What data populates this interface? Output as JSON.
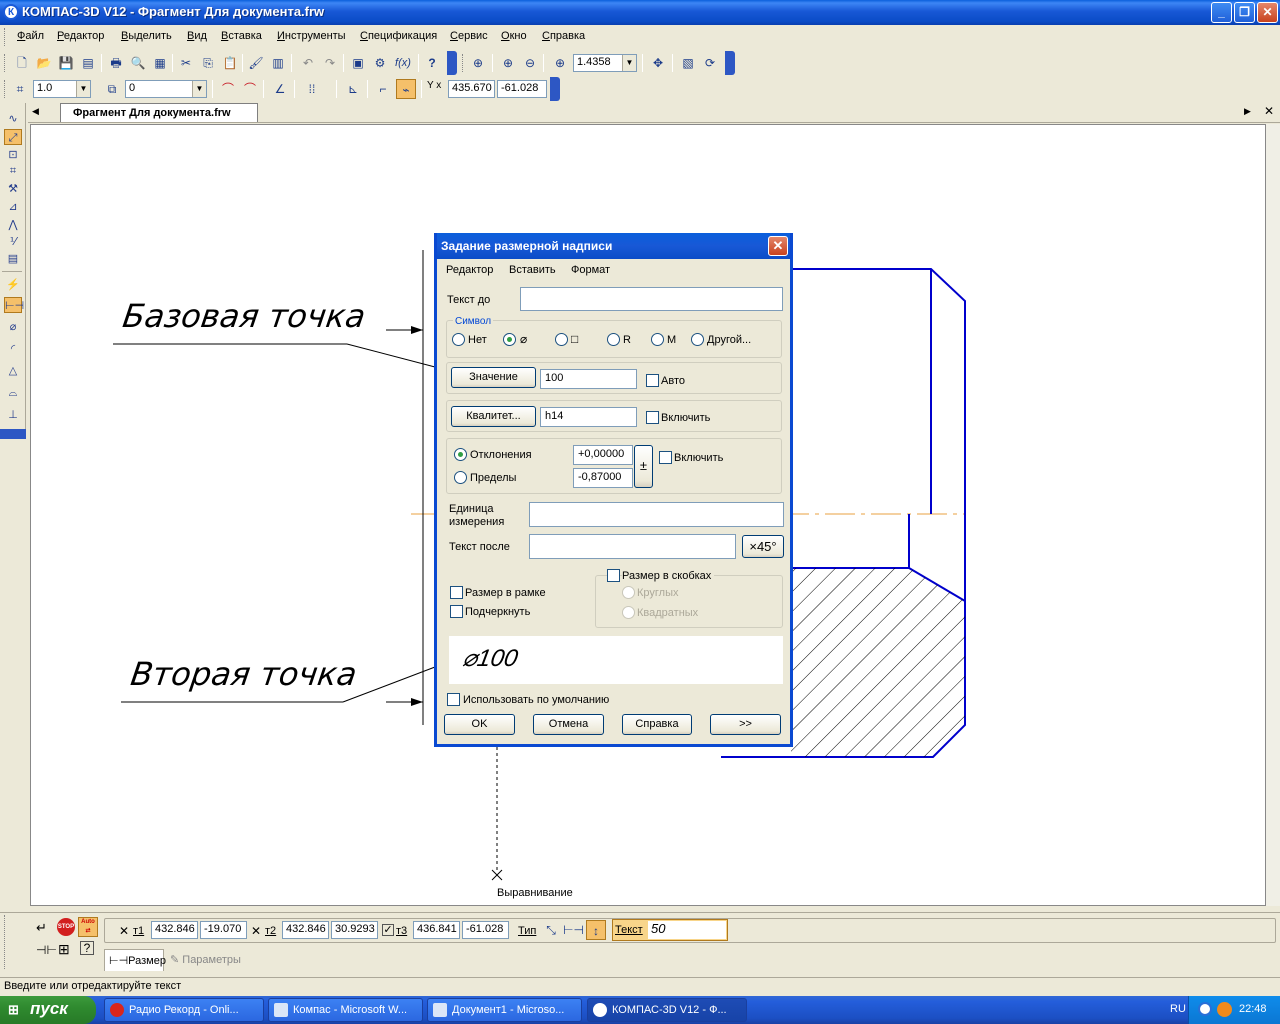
{
  "window": {
    "title": "КОМПАС-3D V12 - Фрагмент Для документа.frw",
    "app_icon_letter": "К"
  },
  "menu": [
    "Файл",
    "Редактор",
    "Выделить",
    "Вид",
    "Вставка",
    "Инструменты",
    "Спецификация",
    "Сервис",
    "Окно",
    "Справка"
  ],
  "toolbar1": {
    "zoom_value": "1.4358"
  },
  "toolbar2": {
    "step_value": "1.0",
    "layer_value": "0",
    "coord_x": "435.670",
    "coord_y": "-61.028",
    "coord_label": "Y x"
  },
  "document_tab": "Фрагмент Для документа.frw",
  "drawing": {
    "base_point_label": "Базовая точка",
    "second_point_label": "Вторая точка",
    "align_label": "Выравнивание"
  },
  "dialog": {
    "title": "Задание размерной надписи",
    "menu": [
      "Редактор",
      "Вставить",
      "Формат"
    ],
    "text_before_label": "Текст до",
    "text_before_value": "",
    "symbol_group_label": "Символ",
    "symbols": [
      {
        "label": "Нет",
        "selected": false
      },
      {
        "label": "⌀",
        "selected": true
      },
      {
        "label": "□",
        "selected": false
      },
      {
        "label": "R",
        "selected": false
      },
      {
        "label": "M",
        "selected": false
      },
      {
        "label": "Другой...",
        "selected": false
      }
    ],
    "value_button": "Значение",
    "value": "100",
    "auto_label": "Авто",
    "qualitet_button": "Квалитет...",
    "qualitet_value": "h14",
    "include_label": "Включить",
    "deviations_label": "Отклонения",
    "limits_label": "Пределы",
    "upper_dev": "+0,00000",
    "lower_dev": "-0,87000",
    "plusminus": "±",
    "include2_label": "Включить",
    "unit_label": "Единица измерения",
    "unit_value": "",
    "text_after_label": "Текст после",
    "text_after_value": "",
    "x45_button": "×45°",
    "brackets_label": "Размер в скобках",
    "round_label": "Круглых",
    "square_label": "Квадратных",
    "frame_label": "Размер в рамке",
    "underline_label": "Подчеркнуть",
    "preview": "⌀100",
    "default_label": "Использовать по умолчанию",
    "ok": "OK",
    "cancel": "Отмена",
    "help": "Справка",
    "more": ">>"
  },
  "property_bar": {
    "t1_label": "т1",
    "t1_x": "432.846",
    "t1_y": "-19.070",
    "t2_label": "т2",
    "t2_x": "432.846",
    "t2_y": "30.9293",
    "t3_label": "т3",
    "t3_x": "436.841",
    "t3_y": "-61.028",
    "type_label": "Тип",
    "text_label": "Текст",
    "text_value": "50",
    "tab_size": "Размер",
    "tab_params": "Параметры",
    "auto_label": "Auto",
    "stop_label": "STOP"
  },
  "status_text": "Введите или отредактируйте текст",
  "taskbar": {
    "start": "пуск",
    "tasks": [
      {
        "label": "Радио Рекорд - Onli...",
        "icon_color": "#d9261c",
        "active": false
      },
      {
        "label": "Компас - Microsoft W...",
        "icon_color": "#2b5fb9",
        "active": false
      },
      {
        "label": "Документ1 - Microso...",
        "icon_color": "#2b5fb9",
        "active": false
      },
      {
        "label": "КОМПАС-3D V12 - Ф...",
        "icon_color": "#ffffff",
        "active": true
      }
    ],
    "lang": "RU",
    "time": "22:48"
  },
  "colors": {
    "xp_blue": "#0A49D1",
    "drawing_blue": "#0000CC",
    "axis_orange": "#E8A040",
    "active_tool": "#F5C06A"
  }
}
